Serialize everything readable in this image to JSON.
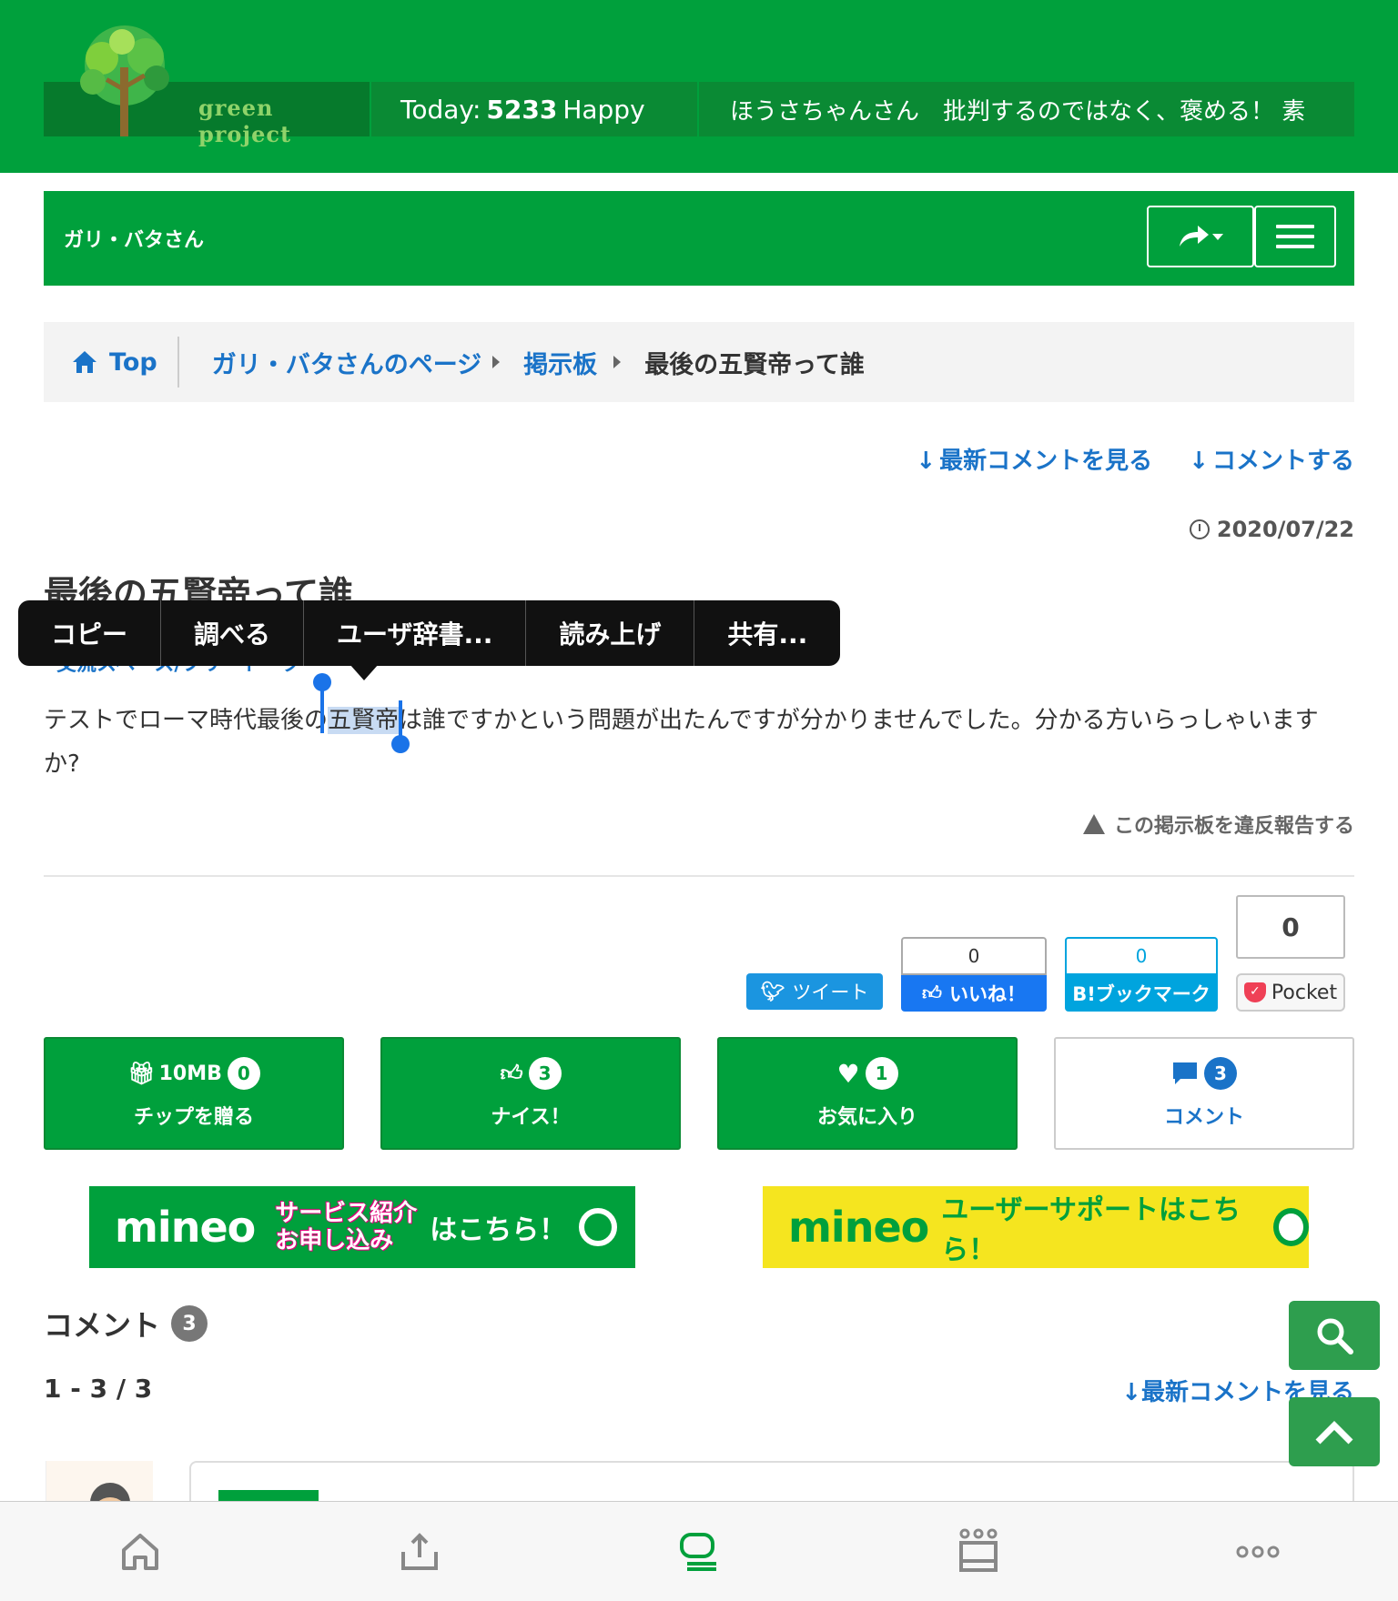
{
  "header": {
    "logo_text": "green project",
    "today_label": "Today:",
    "today_count": "5233",
    "today_suffix": "Happy",
    "ticker": "ほうさちゃんさん　批判するのではなく、褒める！ 素"
  },
  "user_bar": {
    "name": "ガリ・バタさん"
  },
  "breadcrumb": {
    "top": "Top",
    "items": [
      "ガリ・バタさんのページ",
      "掲示板"
    ],
    "current": "最後の五賢帝って誰"
  },
  "actions": {
    "latest": "最新コメントを見る",
    "comment": "コメントする"
  },
  "post": {
    "date": "2020/07/22",
    "title": "最後の五賢帝って誰",
    "category": "交流スペース/フリートーク",
    "body_before": "テストでローマ時代最後の",
    "body_selected": "五賢帝",
    "body_after": "は誰ですかという問題が出たんですが分かりませんでした。分かる方いらっしゃいますか?",
    "report": "この掲示板を違反報告する"
  },
  "context_menu": [
    "コピー",
    "調べる",
    "ユーザ辞書...",
    "読み上げ",
    "共有..."
  ],
  "social": {
    "tweet": "ツイート",
    "fb_count": "0",
    "fb_label": "いいね！",
    "hatena_count": "0",
    "hatena_label": "B!ブックマーク",
    "pocket_count": "0",
    "pocket_label": "Pocket"
  },
  "buttons": {
    "tip_mb": "10MB",
    "tip_count": "0",
    "tip_label": "チップを贈る",
    "nice_count": "3",
    "nice_label": "ナイス！",
    "fav_count": "1",
    "fav_label": "お気に入り",
    "comment_count": "3",
    "comment_label": "コメント"
  },
  "banners": {
    "brand": "mineo",
    "left_promo_1": "サービス紹介",
    "left_promo_2": "お申し込み",
    "left_here": "はこちら！",
    "right_text": "ユーザーサポートはこちら！"
  },
  "comments": {
    "title": "コメント",
    "count": "3",
    "paging": "1 - 3 / 3",
    "latest": "最新コメントを見る"
  },
  "colors": {
    "brand_green": "#00a03c",
    "link_blue": "#1a73c8"
  }
}
